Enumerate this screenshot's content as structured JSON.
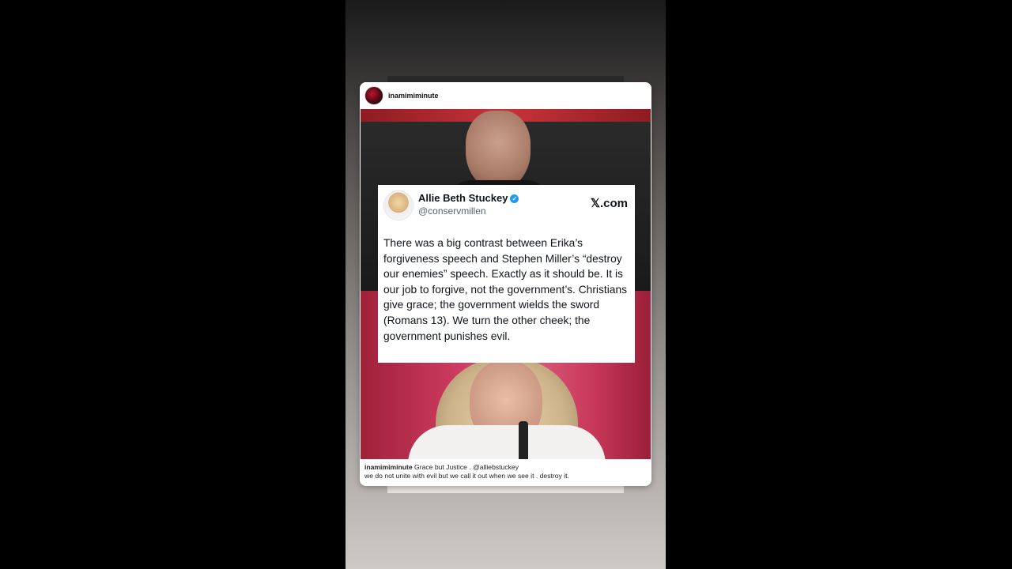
{
  "post": {
    "username": "inamimiminute",
    "avatar_icon": "profile-avatar-icon"
  },
  "tweet": {
    "name": "Allie Beth Stuckey",
    "verified_icon": "verified-badge-icon",
    "verified_glyph": "✓",
    "handle": "@conservmillen",
    "source": "𝕏.com",
    "text": "There was a big contrast between Erika’s forgiveness speech and Stephen Miller’s “destroy our enemies” speech. Exactly as it should be. It is our job to forgive, not the government’s. Christians give grace; the government wields the sword (Romans 13). We turn the other cheek; the government punishes evil."
  },
  "caption": {
    "username": "inamimiminute",
    "line1": "Grace but Justice .  @alliebstuckey",
    "line2": "we do not unite with evil but we call it out when we see it . destroy it."
  },
  "colors": {
    "verified": "#1d9bf0",
    "handle": "#536471",
    "stage_red": "#c8333a"
  }
}
